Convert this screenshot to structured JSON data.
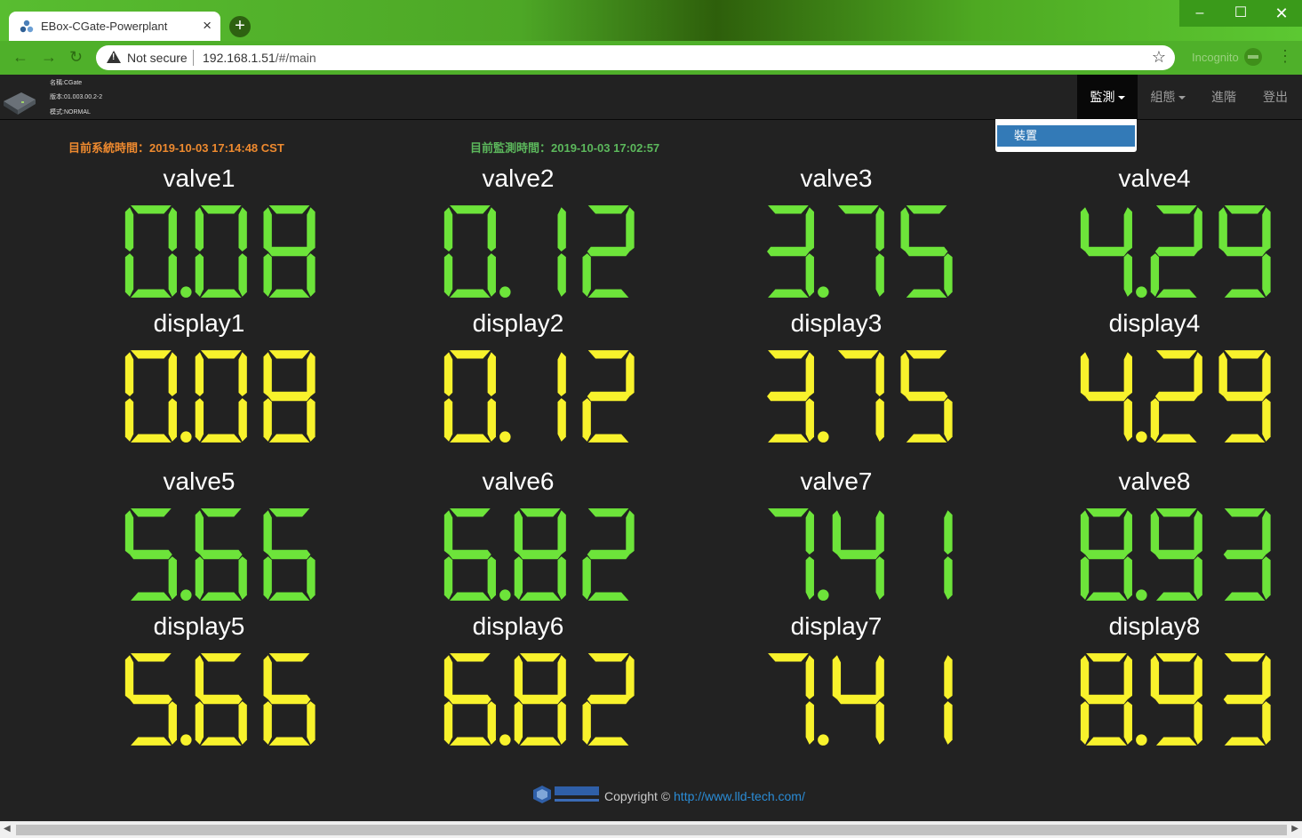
{
  "browser": {
    "tab_title": "EBox-CGate-Powerplant",
    "tab_close": "×",
    "new_tab": "+",
    "security": "Not secure",
    "url_host": "192.168.1.51",
    "url_path": "/#/main",
    "incognito": "Incognito",
    "window_min": "–",
    "window_max": "☐",
    "window_close": "✕"
  },
  "device": {
    "name": "名稱:CGate",
    "version": "版本:01.003.00.2-2",
    "mode": "模式:NORMAL"
  },
  "nav": {
    "items": [
      {
        "label": "監測",
        "caret": true,
        "active": true
      },
      {
        "label": "組態",
        "caret": true,
        "active": false
      },
      {
        "label": "進階",
        "caret": false,
        "active": false
      },
      {
        "label": "登出",
        "caret": false,
        "active": false
      }
    ],
    "dropdown_item": "裝置"
  },
  "status": {
    "system_time": "目前系統時間：2019-10-03 17:14:48 CST",
    "monitor_time": "目前監測時間：2019-10-03 17:02:57"
  },
  "colors": {
    "valve": "#6de43a",
    "display": "#f8f22c",
    "system_time": "#ee8a2f",
    "monitor_time": "#5cb85c"
  },
  "gauges": [
    {
      "label": "valve1",
      "value": "0.08",
      "kind": "valve"
    },
    {
      "label": "valve2",
      "value": "0.12",
      "kind": "valve"
    },
    {
      "label": "valve3",
      "value": "3.75",
      "kind": "valve"
    },
    {
      "label": "valve4",
      "value": "4.29",
      "kind": "valve"
    },
    {
      "label": "display1",
      "value": "0.08",
      "kind": "display"
    },
    {
      "label": "display2",
      "value": "0.12",
      "kind": "display"
    },
    {
      "label": "display3",
      "value": "3.75",
      "kind": "display"
    },
    {
      "label": "display4",
      "value": "4.29",
      "kind": "display"
    },
    {
      "label": "valve5",
      "value": "5.66",
      "kind": "valve"
    },
    {
      "label": "valve6",
      "value": "6.82",
      "kind": "valve"
    },
    {
      "label": "valve7",
      "value": "7.41",
      "kind": "valve"
    },
    {
      "label": "valve8",
      "value": "8.93",
      "kind": "valve"
    },
    {
      "label": "display5",
      "value": "5.66",
      "kind": "display"
    },
    {
      "label": "display6",
      "value": "6.82",
      "kind": "display"
    },
    {
      "label": "display7",
      "value": "7.41",
      "kind": "display"
    },
    {
      "label": "display8",
      "value": "8.93",
      "kind": "display"
    }
  ],
  "footer": {
    "copyright": "Copyright © ",
    "link": "http://www.lld-tech.com/"
  }
}
